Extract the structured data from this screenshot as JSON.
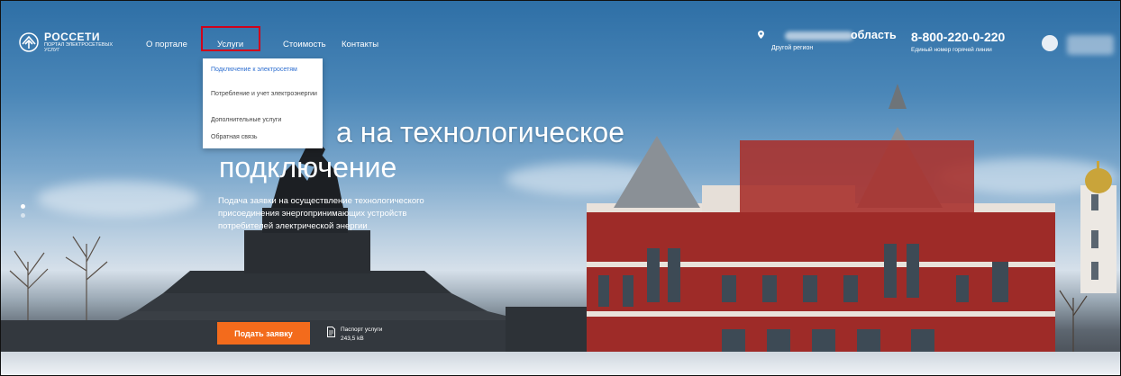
{
  "logo": {
    "title": "РОССЕТИ",
    "subtitle": "ПОРТАЛ ЭЛЕКТРОСЕТЕВЫХ УСЛУГ",
    "icon": "rosseti-logo-icon"
  },
  "nav": {
    "items": [
      {
        "label": "О портале"
      },
      {
        "label": "Услуги"
      },
      {
        "label": "Стоимость"
      },
      {
        "label": "Контакты"
      }
    ],
    "highlighted": "Услуги",
    "highlight_color": "#d0021b"
  },
  "dropdown": {
    "items": [
      {
        "label": "Подключение к электросетям",
        "active": true
      },
      {
        "label": "Потребление и учет электроэнергии",
        "active": false
      },
      {
        "label": "Дополнительные услуги",
        "active": false
      },
      {
        "label": "Обратная связь",
        "active": false
      }
    ],
    "active_color": "#2f6fd0"
  },
  "region": {
    "name": "область",
    "other_label": "Другой регион",
    "icon": "location-pin-icon"
  },
  "hotline": {
    "number": "8-800-220-0-220",
    "caption": "Единый номер горячей линии"
  },
  "hero": {
    "title_line1": "а на технологическое",
    "title_line2": "подключение",
    "description": "Подача заявки на осуществление технологического присоединения энергопринимающих устройств потребителей электрической энергии"
  },
  "cta": {
    "label": "Подать заявку",
    "color": "#f36b1c"
  },
  "passport": {
    "label": "Паспорт услуги",
    "size": "243,5 kB",
    "icon": "document-icon"
  }
}
